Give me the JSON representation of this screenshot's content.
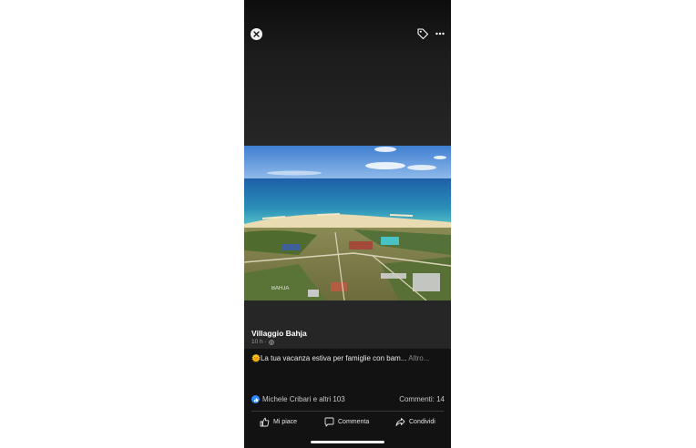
{
  "post": {
    "page_name": "Villaggio Bahja",
    "time": "10 h",
    "audience_icon": "globe-icon",
    "caption_emoji": "🌞",
    "caption_text": "La tua vacanza estiva per famiglie con bam...",
    "caption_more": "Altro..."
  },
  "photo": {
    "watermark": "BAHJA"
  },
  "reactions": {
    "text": "Michele Cribari e altri 103",
    "comments": "Commenti: 14"
  },
  "actions": {
    "like": "Mi piace",
    "comment": "Commenta",
    "share": "Condividi"
  },
  "icons": {
    "close": "close-icon",
    "tag": "tag-icon",
    "more": "more-icon",
    "like": "thumbs-up-icon",
    "comment": "comment-icon",
    "share": "share-icon"
  },
  "colors": {
    "like_badge": "#2d88ff",
    "background": "#262626"
  }
}
